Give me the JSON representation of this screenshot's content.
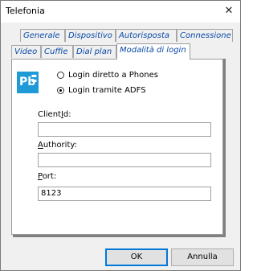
{
  "window": {
    "title": "Telefonia",
    "close_icon": "close-icon"
  },
  "tabs_row1": [
    {
      "label": "Generale"
    },
    {
      "label": "Dispositivo"
    },
    {
      "label": "Autorisposta"
    },
    {
      "label": "Connessione"
    }
  ],
  "tabs_row2": [
    {
      "label": "Video"
    },
    {
      "label": "Cuffie"
    },
    {
      "label": "Dial plan"
    },
    {
      "label": "Modalità di login",
      "active": true
    }
  ],
  "panel": {
    "logo_text": "Pb",
    "radio_options": [
      {
        "label": "Login diretto a Phones",
        "checked": false
      },
      {
        "label": "Login tramite ADFS",
        "checked": true
      }
    ],
    "client_id": {
      "label_pre": "Client",
      "label_ul": "I",
      "label_post": "d:",
      "value": ""
    },
    "authority": {
      "label_pre": "",
      "label_ul": "A",
      "label_post": "uthority:",
      "value": ""
    },
    "port": {
      "label_pre": "",
      "label_ul": "P",
      "label_post": "ort:",
      "value": "8123"
    }
  },
  "buttons": {
    "ok": "OK",
    "cancel": "Annulla"
  },
  "colors": {
    "tab_text": "#0a4aa8",
    "logo_bg": "#1e9ad6",
    "ok_border": "#0078d7"
  }
}
